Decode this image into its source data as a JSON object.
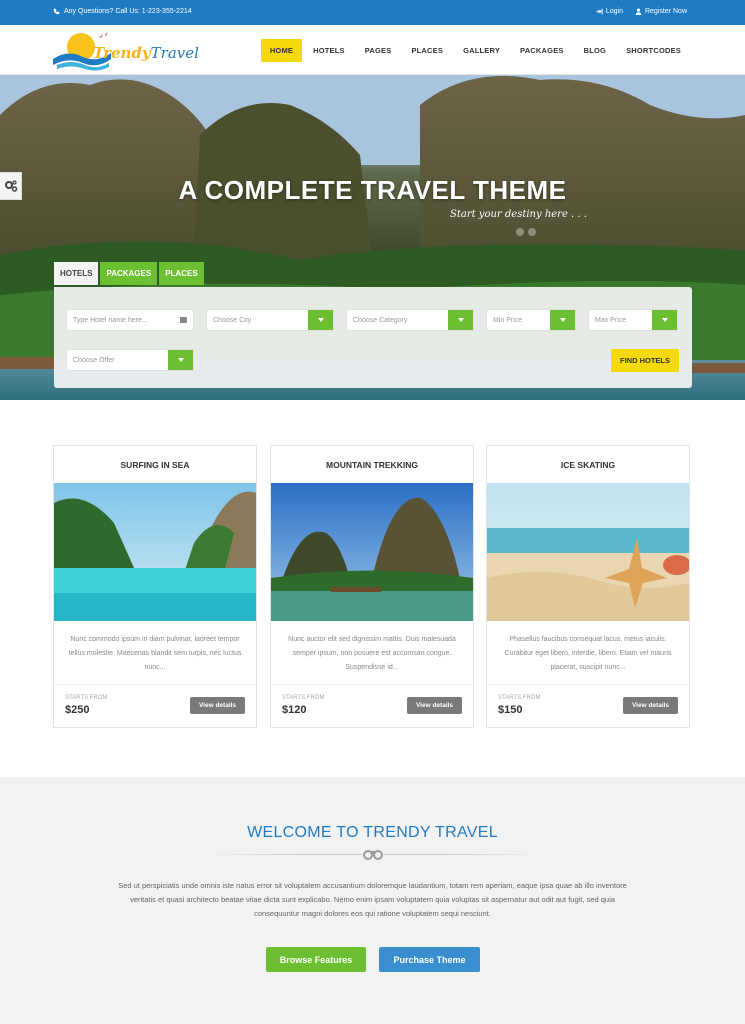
{
  "topbar": {
    "contact": "Any Questions? Call Us: 1-223-355-2214",
    "login": "Login",
    "register": "Register Now"
  },
  "logo": {
    "part1": "Trendy",
    "part2": "Travel"
  },
  "nav": {
    "items": [
      {
        "label": "HOME"
      },
      {
        "label": "HOTELS"
      },
      {
        "label": "PAGES"
      },
      {
        "label": "PLACES"
      },
      {
        "label": "GALLERY"
      },
      {
        "label": "PACKAGES"
      },
      {
        "label": "BLOG"
      },
      {
        "label": "SHORTCODES"
      }
    ]
  },
  "hero": {
    "title": "A COMPLETE TRAVEL THEME",
    "subtitle": "Start your destiny here . . ."
  },
  "search": {
    "tabs": [
      {
        "label": "HOTELS"
      },
      {
        "label": "PACKAGES"
      },
      {
        "label": "PLACES"
      }
    ],
    "hotel_name_placeholder": "Type Hotel name here...",
    "city": "Choose City",
    "category": "Choose Category",
    "min_price": "Min Price",
    "max_price": "Max Price",
    "offer": "Choose Offer",
    "find_label": "FIND HOTELS"
  },
  "cards": [
    {
      "title": "SURFING IN SEA",
      "desc": "Nunc commodo ipsum in diam pulvinar, laoreet tempor tellus molestie. Maecenas blandit sem turpis, nec luctus nunc...",
      "starts": "STARTS FROM",
      "price": "$250",
      "button": "View details"
    },
    {
      "title": "MOUNTAIN TREKKING",
      "desc": "Nunc auctor elit sed dignissim mattis. Duis malesuada semper ipsum, non posuere est accumsan congue. Suspendisse id...",
      "starts": "STARTS FROM",
      "price": "$120",
      "button": "View details"
    },
    {
      "title": "ICE SKATING",
      "desc": "Phasellus faucibus consequat lacus, metus iaculis. Curabitur eget libero, interdie, libero. Etiam vel mauris placerat, suscipit nunc...",
      "starts": "STARTS FROM",
      "price": "$150",
      "button": "View details"
    }
  ],
  "welcome": {
    "title": "WELCOME TO TRENDY TRAVEL",
    "text": "Sed ut perspiciatis unde omnis iste natus error sit voluptatem accusantium doloremque laudantium, totam rem aperiam, eaque ipsa quae ab illo inventore veritatis et quasi architecto beatae vitae dicta sunt explicabo. Nemo enim ipsam voluptatem quia voluptas sit aspernatur aut odit aut fugit, sed quia consequuntur magni dolores eos qui ratione voluptatem sequi nesciunt.",
    "browse_label": "Browse Features",
    "purchase_label": "Purchase Theme"
  },
  "colors": {
    "primary_blue": "#1f7bc4",
    "accent_yellow": "#f5d90a",
    "accent_green": "#6cbf30",
    "button_gray": "#7a7a7a"
  },
  "icons": [
    "phone-icon",
    "login-icon",
    "user-icon",
    "gear-icon",
    "calendar-icon",
    "chevron-down-icon",
    "binoculars-icon"
  ]
}
